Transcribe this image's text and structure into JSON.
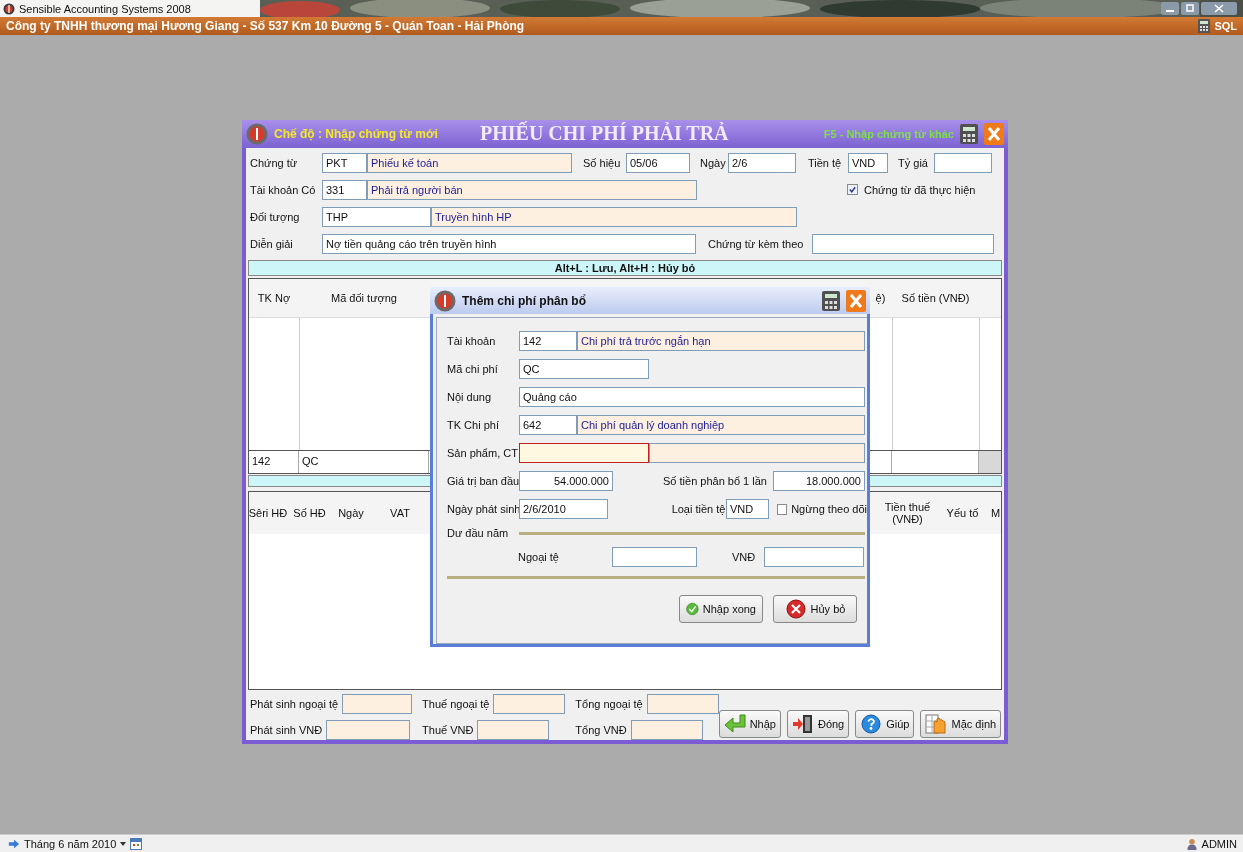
{
  "app": {
    "title": "Sensible Accounting Systems 2008"
  },
  "company_bar": {
    "text": "Công ty TNHH thương mại Hương Giang - Số 537 Km 10 Đường 5 - Quán Toan - Hải Phòng",
    "db_label": "SQL"
  },
  "voucher_form": {
    "mode": "Chế độ : Nhập chứng từ mới",
    "title": "PHIẾU CHI PHÍ PHẢI TRẢ",
    "hint": "F5 - Nhập chứng từ khác",
    "voucher": {
      "label": "Chứng từ",
      "code": "PKT",
      "name": "Phiếu kế toán"
    },
    "number": {
      "label": "Số hiệu",
      "value": "05/06"
    },
    "date": {
      "label": "Ngày",
      "value": "2/6"
    },
    "currency": {
      "label": "Tiền tệ",
      "value": "VND"
    },
    "rate": {
      "label": "Tỷ giá"
    },
    "credit_account": {
      "label": "Tài khoản Có",
      "code": "331",
      "name": "Phải trả người bán"
    },
    "executed": {
      "label": "Chứng từ đã thực hiện",
      "checked": true
    },
    "party": {
      "label": "Đối tượng",
      "code": "THP",
      "name": "Truyền hình HP"
    },
    "description": {
      "label": "Diễn giải",
      "value": "Nợ tiền quảng cáo trên truyền hình"
    },
    "attachments": {
      "label": "Chứng từ kèm theo"
    },
    "hotkeys": "Alt+L : Lưu,  Alt+H : Hủy bỏ",
    "entries_table": {
      "columns": [
        "TK Nợ",
        "Mã đối tượng",
        "ệ)",
        "Số tiền (VNĐ)"
      ],
      "rows": [
        [
          "142",
          "QC"
        ]
      ]
    },
    "invoice_table": {
      "columns": [
        "Sêri HĐ",
        "Số HĐ",
        "Ngày",
        "VAT",
        "Tiền thuế (VNĐ)",
        "Yếu tố",
        "M"
      ]
    },
    "totals": [
      {
        "label": "Phát sinh ngoại tệ"
      },
      {
        "label": "Thuế ngoại tệ"
      },
      {
        "label": "Tổng ngoại tệ"
      },
      {
        "label": "Phát sinh VNĐ"
      },
      {
        "label": "Thuế VNĐ"
      },
      {
        "label": "Tổng VNĐ"
      }
    ],
    "buttons": [
      {
        "label": "Nhập",
        "kind": "enter"
      },
      {
        "label": "Đóng",
        "kind": "close"
      },
      {
        "label": "Giúp",
        "kind": "help"
      },
      {
        "label": "Mặc định",
        "kind": "default"
      }
    ]
  },
  "dialog": {
    "title": "Thêm chi phí phân bổ",
    "account": {
      "label": "Tài khoản",
      "code": "142",
      "name": "Chi phí trả trước ngắn hạn"
    },
    "cost_code": {
      "label": "Mã chi phí",
      "value": "QC"
    },
    "content": {
      "label": "Nội dung",
      "value": "Quảng cáo"
    },
    "expense_account": {
      "label": "TK Chi phí",
      "code": "642",
      "name": "Chi phí quản lý doanh nghiệp"
    },
    "product": {
      "label": "Sản phẩm, CT",
      "focused": true
    },
    "initial_value": {
      "label": "Giá trị ban đầu",
      "value": "54.000.000"
    },
    "allocation": {
      "label": "Số tiền phân bổ 1 lần",
      "value": "18.000.000"
    },
    "issue_date": {
      "label": "Ngày phát sinh",
      "value": "2/6/2010"
    },
    "currency_type": {
      "label": "Loại tiền tệ",
      "value": "VND"
    },
    "stop_tracking": {
      "label": "Ngừng theo dõi",
      "checked": false
    },
    "opening_balance": {
      "label": "Dư đầu năm",
      "foreign_label": "Ngoại tệ",
      "vnd_label": "VNĐ"
    },
    "buttons": [
      {
        "label": "Nhập xong",
        "kind": "ok"
      },
      {
        "label": "Hủy bỏ",
        "kind": "cancel"
      }
    ]
  },
  "status_bar": {
    "period": "Tháng 6 năm 2010",
    "user": "ADMIN"
  }
}
